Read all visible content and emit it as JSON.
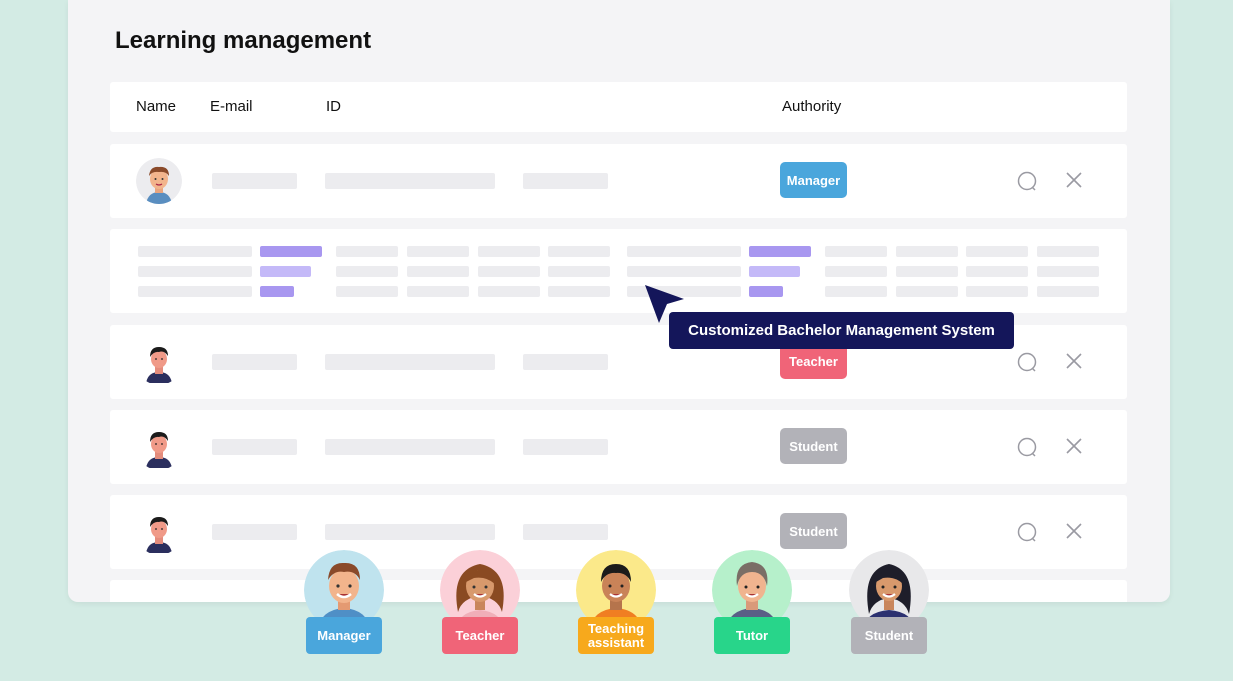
{
  "title": "Learning management",
  "columns": {
    "name": "Name",
    "email": "E-mail",
    "id": "ID",
    "authority": "Authority"
  },
  "rows": [
    {
      "role": "Manager",
      "color": "#4aa6dc"
    },
    {
      "role": "Teacher",
      "color": "#f06478"
    },
    {
      "role": "Student",
      "color": "#b2b2b8"
    },
    {
      "role": "Student",
      "color": "#b2b2b8"
    }
  ],
  "tooltip": "Customized Bachelor Management System",
  "roles": [
    {
      "label": "Manager",
      "color": "#4aa6dc",
      "bg": "#bfe3ee"
    },
    {
      "label": "Teacher",
      "color": "#f06478",
      "bg": "#fbd0d8"
    },
    {
      "label": "Teaching assistant",
      "color": "#f7a91c",
      "bg": "#fbe98a"
    },
    {
      "label": "Tutor",
      "color": "#28d58a",
      "bg": "#b6f0cb"
    },
    {
      "label": "Student",
      "color": "#b2b2b8",
      "bg": "#e8e8ea"
    }
  ]
}
